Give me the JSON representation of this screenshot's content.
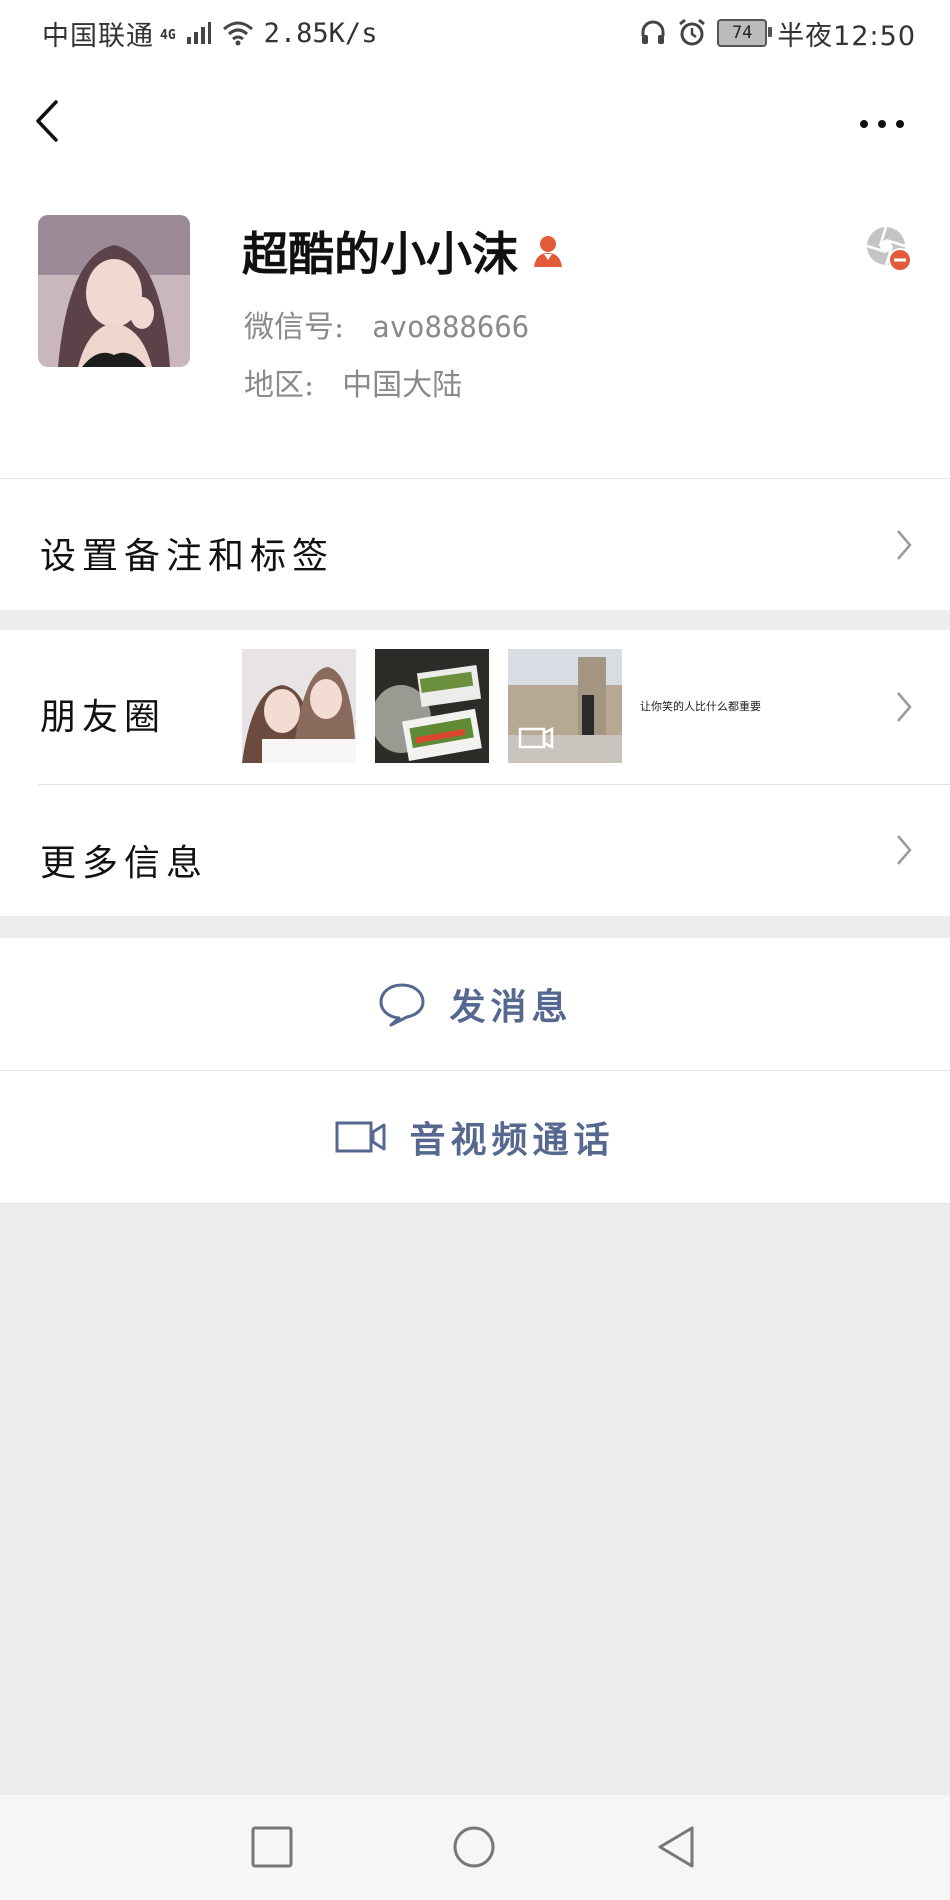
{
  "status_bar": {
    "carrier": "中国联通",
    "network": "4G",
    "speed": "2.85K/s",
    "battery": "74",
    "time": "半夜12:50"
  },
  "nav": {
    "back_icon": "chevron-left-icon",
    "more_icon": "more-dots-icon"
  },
  "profile": {
    "name": "超酷的小小沫",
    "gender_icon": "female-icon",
    "wechat_id_label": "微信号:",
    "wechat_id": "avo888666",
    "region_label": "地区:",
    "region": "中国大陆",
    "accent_color": "#e35b3a"
  },
  "rows": {
    "remark": "设置备注和标签",
    "moments": "朋友圈",
    "moments_text": "让你笑的人比什么都重要",
    "more_info": "更多信息"
  },
  "actions": {
    "message": "发消息",
    "video_call": "音视频通话",
    "color": "#56688f"
  },
  "system_nav": {
    "icons": [
      "recents-square-icon",
      "home-circle-icon",
      "back-triangle-icon"
    ]
  }
}
